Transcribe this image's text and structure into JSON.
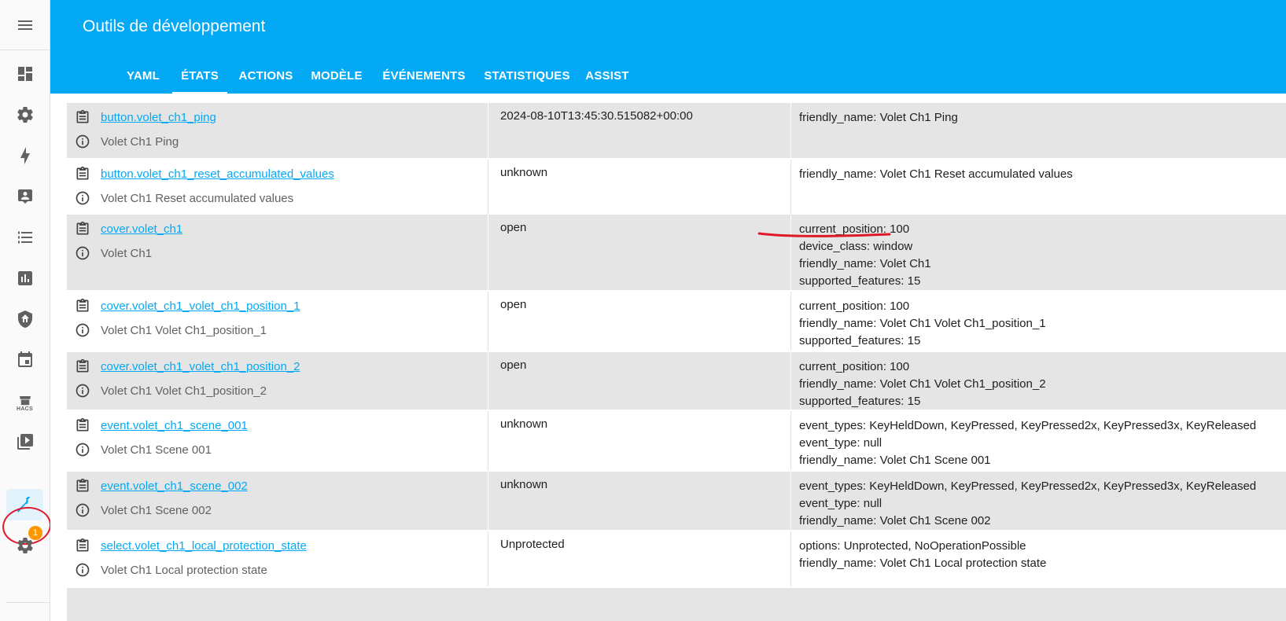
{
  "header": {
    "title": "Outils de développement",
    "tabs": [
      "YAML",
      "ÉTATS",
      "ACTIONS",
      "MODÈLE",
      "ÉVÉNEMENTS",
      "STATISTIQUES",
      "ASSIST"
    ],
    "active_tab": "ÉTATS"
  },
  "sidebar": {
    "items": [
      "menu-icon",
      "overview-icon",
      "settings-icon",
      "energy-icon",
      "logbook-icon",
      "todo-icon",
      "history-icon",
      "security-icon",
      "calendar-icon",
      "hacs-icon",
      "media-icon",
      "developer-tools-icon",
      "settings-notification-icon"
    ],
    "hacs_label": "HACS",
    "notification_count": "1"
  },
  "accent_color": "#03a9f4",
  "rows": [
    {
      "entity_id": "button.volet_ch1_ping",
      "name": "Volet Ch1 Ping",
      "state": "2024-08-10T13:45:30.515082+00:00",
      "attributes": [
        {
          "key": "friendly_name",
          "value": "Volet Ch1 Ping"
        }
      ]
    },
    {
      "entity_id": "button.volet_ch1_reset_accumulated_values",
      "name": "Volet Ch1 Reset accumulated values",
      "state": "unknown",
      "attributes": [
        {
          "key": "friendly_name",
          "value": "Volet Ch1 Reset accumulated values"
        }
      ]
    },
    {
      "entity_id": "cover.volet_ch1",
      "name": "Volet Ch1",
      "state": "open",
      "attributes": [
        {
          "key": "current_position",
          "value": "100"
        },
        {
          "key": "device_class",
          "value": "window"
        },
        {
          "key": "friendly_name",
          "value": "Volet Ch1"
        },
        {
          "key": "supported_features",
          "value": "15"
        }
      ]
    },
    {
      "entity_id": "cover.volet_ch1_volet_ch1_position_1",
      "name": "Volet Ch1 Volet Ch1_position_1",
      "state": "open",
      "attributes": [
        {
          "key": "current_position",
          "value": "100"
        },
        {
          "key": "friendly_name",
          "value": "Volet Ch1 Volet Ch1_position_1"
        },
        {
          "key": "supported_features",
          "value": "15"
        }
      ]
    },
    {
      "entity_id": "cover.volet_ch1_volet_ch1_position_2",
      "name": "Volet Ch1 Volet Ch1_position_2",
      "state": "open",
      "attributes": [
        {
          "key": "current_position",
          "value": "100"
        },
        {
          "key": "friendly_name",
          "value": "Volet Ch1 Volet Ch1_position_2"
        },
        {
          "key": "supported_features",
          "value": "15"
        }
      ]
    },
    {
      "entity_id": "event.volet_ch1_scene_001",
      "name": "Volet Ch1 Scene 001",
      "state": "unknown",
      "attributes": [
        {
          "key": "event_types",
          "value": "KeyHeldDown, KeyPressed, KeyPressed2x, KeyPressed3x, KeyReleased"
        },
        {
          "key": "event_type",
          "value": "null"
        },
        {
          "key": "friendly_name",
          "value": "Volet Ch1 Scene 001"
        }
      ]
    },
    {
      "entity_id": "event.volet_ch1_scene_002",
      "name": "Volet Ch1 Scene 002",
      "state": "unknown",
      "attributes": [
        {
          "key": "event_types",
          "value": "KeyHeldDown, KeyPressed, KeyPressed2x, KeyPressed3x, KeyReleased"
        },
        {
          "key": "event_type",
          "value": "null"
        },
        {
          "key": "friendly_name",
          "value": "Volet Ch1 Scene 002"
        }
      ]
    },
    {
      "entity_id": "select.volet_ch1_local_protection_state",
      "name": "Volet Ch1 Local protection state",
      "state": "Unprotected",
      "attributes": [
        {
          "key": "options",
          "value": "Unprotected, NoOperationPossible"
        },
        {
          "key": "friendly_name",
          "value": "Volet Ch1 Local protection state"
        }
      ]
    }
  ]
}
